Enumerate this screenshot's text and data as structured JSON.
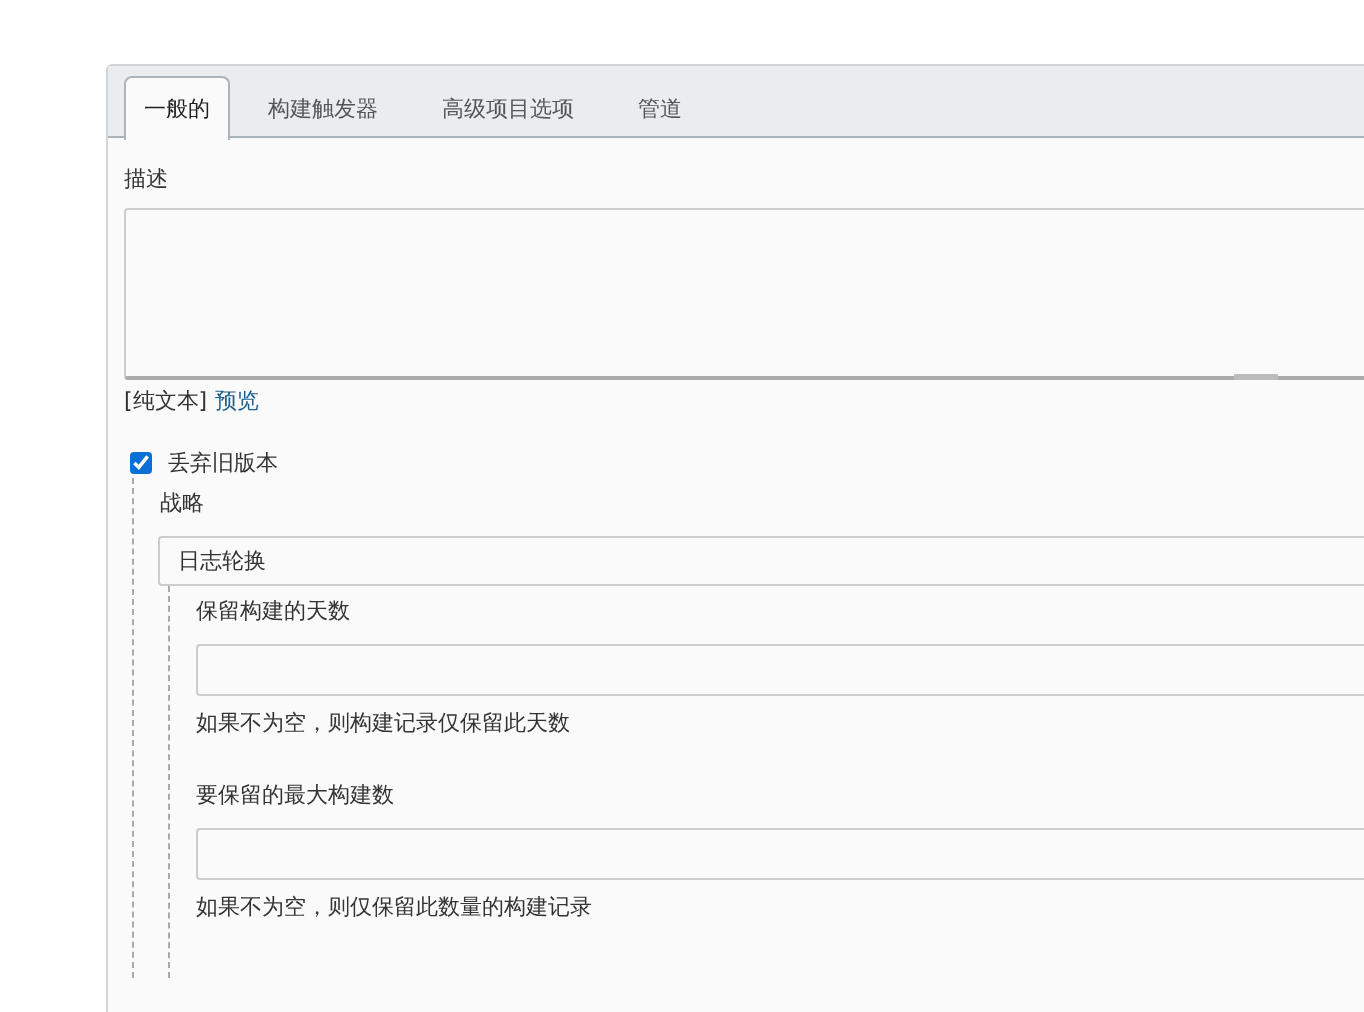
{
  "tabs": [
    {
      "label": "一般的",
      "selected": true
    },
    {
      "label": "构建触发器",
      "selected": false
    },
    {
      "label": "高级项目选项",
      "selected": false
    },
    {
      "label": "管道",
      "selected": false
    }
  ],
  "description": {
    "label": "描述",
    "format": "[纯文本]",
    "preview_link": "预览"
  },
  "discard_old_builds": {
    "label": "丢弃旧版本",
    "checked": true,
    "strategy": {
      "label": "战略",
      "value": "日志轮换",
      "fields": [
        {
          "label": "保留构建的天数",
          "help": "如果不为空，则构建记录仅保留此天数"
        },
        {
          "label": "要保留的最大构建数",
          "help": "如果不为空，则仅保留此数量的构建记录"
        }
      ]
    }
  }
}
